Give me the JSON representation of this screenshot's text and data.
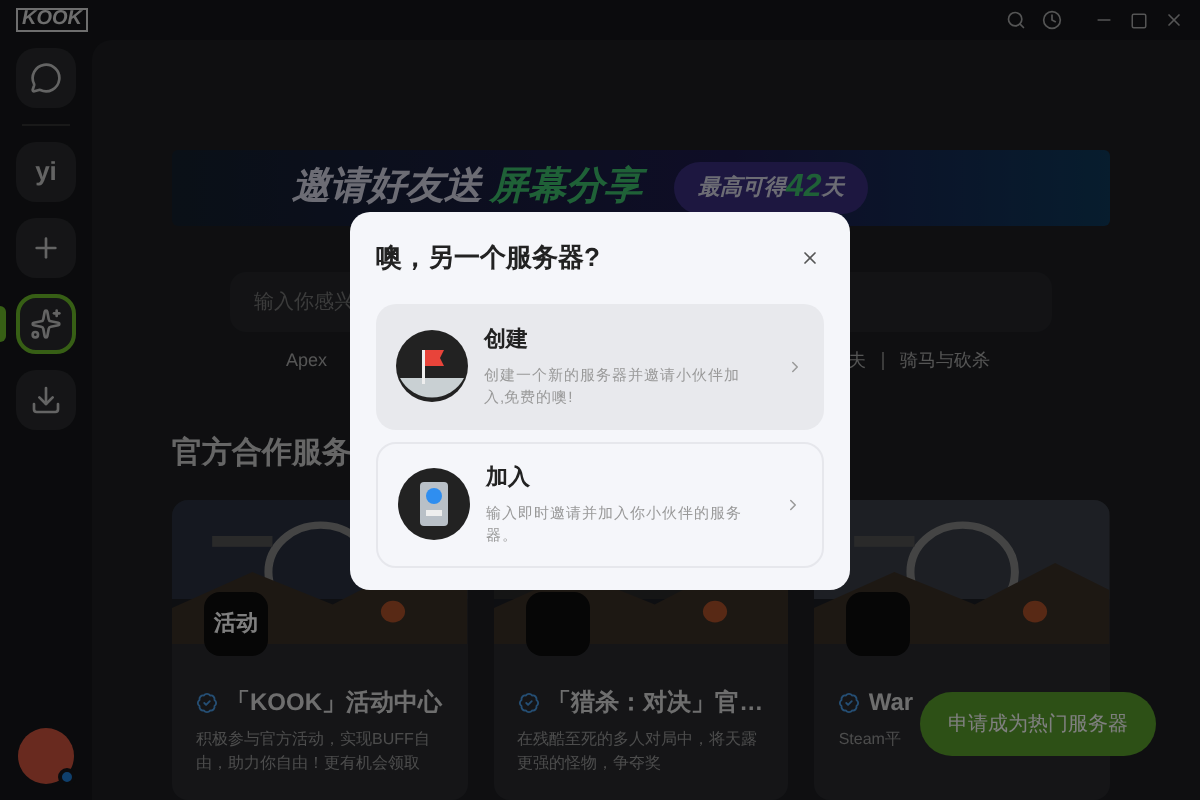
{
  "app": {
    "logo": "KOOK"
  },
  "sidebar": {
    "items": [
      {
        "kind": "home",
        "selected": false
      },
      {
        "kind": "server",
        "label": "yi",
        "selected": false
      },
      {
        "kind": "add",
        "selected": false
      },
      {
        "kind": "discover",
        "selected": true
      },
      {
        "kind": "download",
        "selected": false
      }
    ]
  },
  "banner": {
    "headline": "邀请好友送",
    "highlight": "屏幕分享",
    "badge_prefix": "最高可得",
    "badge_number": "42",
    "badge_suffix": "天"
  },
  "search": {
    "placeholder": "输入你感兴"
  },
  "tags": [
    "Apex",
    "夫",
    "骑马与砍杀"
  ],
  "section_title": "官方合作服务",
  "cards": [
    {
      "icon_label": "活动",
      "title": "「KOOK」活动中心",
      "description": "积极参与官方活动，实现BUFF自由，助力你自由！更有机会领取",
      "verified": true
    },
    {
      "title": "「猎杀：对决」官…",
      "description": "在残酷至死的多人对局中，将天露更强的怪物，争夺奖",
      "verified": true
    },
    {
      "title": "War",
      "description": "Steam平",
      "verified": true
    }
  ],
  "apply_button": "申请成为热门服务器",
  "dialog": {
    "title": "噢，另一个服务器?",
    "options": [
      {
        "kind": "create",
        "title": "创建",
        "description": "创建一个新的服务器并邀请小伙伴加入,免费的噢!",
        "highlighted": true
      },
      {
        "kind": "join",
        "title": "加入",
        "description": "输入即时邀请并加入你小伙伴的服务器。",
        "highlighted": false
      }
    ]
  }
}
